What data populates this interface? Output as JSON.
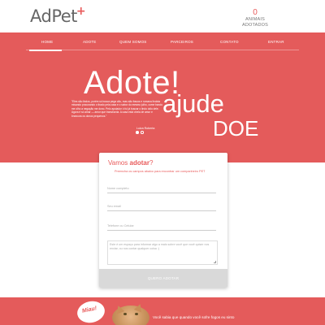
{
  "header": {
    "logo_text": "AdPet",
    "logo_plus": "+",
    "counter_value": "0",
    "counter_line1": "ANIMAIS",
    "counter_line2": "ADOTADOS"
  },
  "nav": {
    "items": [
      "HOME",
      "ADOTE",
      "QUEM SOMOS",
      "PARCEIROS",
      "CONTATO",
      "ENTRAR"
    ],
    "active": "HOME"
  },
  "hero": {
    "headline_1": "Adote!",
    "headline_2": "ajude",
    "headline_3": "DOE",
    "quote": "\"Eles são lindos, porém só busca pega cão, mas são fracos e romana lindota misando procurando o tirado pela casa e o sabor do mesmo julho, come bando me olho a negação me dono. Pelo apoiador ó fui já buscar o lindo ódio dele. Agora é só amar — amor que transborda. A casa está cheia de amor e brancura os donos pequenos.\"",
    "quote_author": "Luiza Roberta"
  },
  "form": {
    "title_prefix": "Vamos ",
    "title_bold": "adotar",
    "title_suffix": "?",
    "subtitle": "Preencha os campos abaixo para encontrar um companheiro PET",
    "name_placeholder": "Nome completo",
    "email_placeholder": "Seu email",
    "phone_placeholder": "Telefone ou Celular",
    "message_placeholder": "Este é um espaço para informar algo a mais sobre você que você quiser nos enviar, ou nos contar qualquer coisa :)",
    "submit_label": "QUERO ADOTAR"
  },
  "bottom": {
    "badge": "Miau!",
    "text": "Você sabia que quando você sofre fogos eu sinto"
  },
  "colors": {
    "brand": "#e45b5b",
    "button_disabled": "#d9d9d9"
  }
}
